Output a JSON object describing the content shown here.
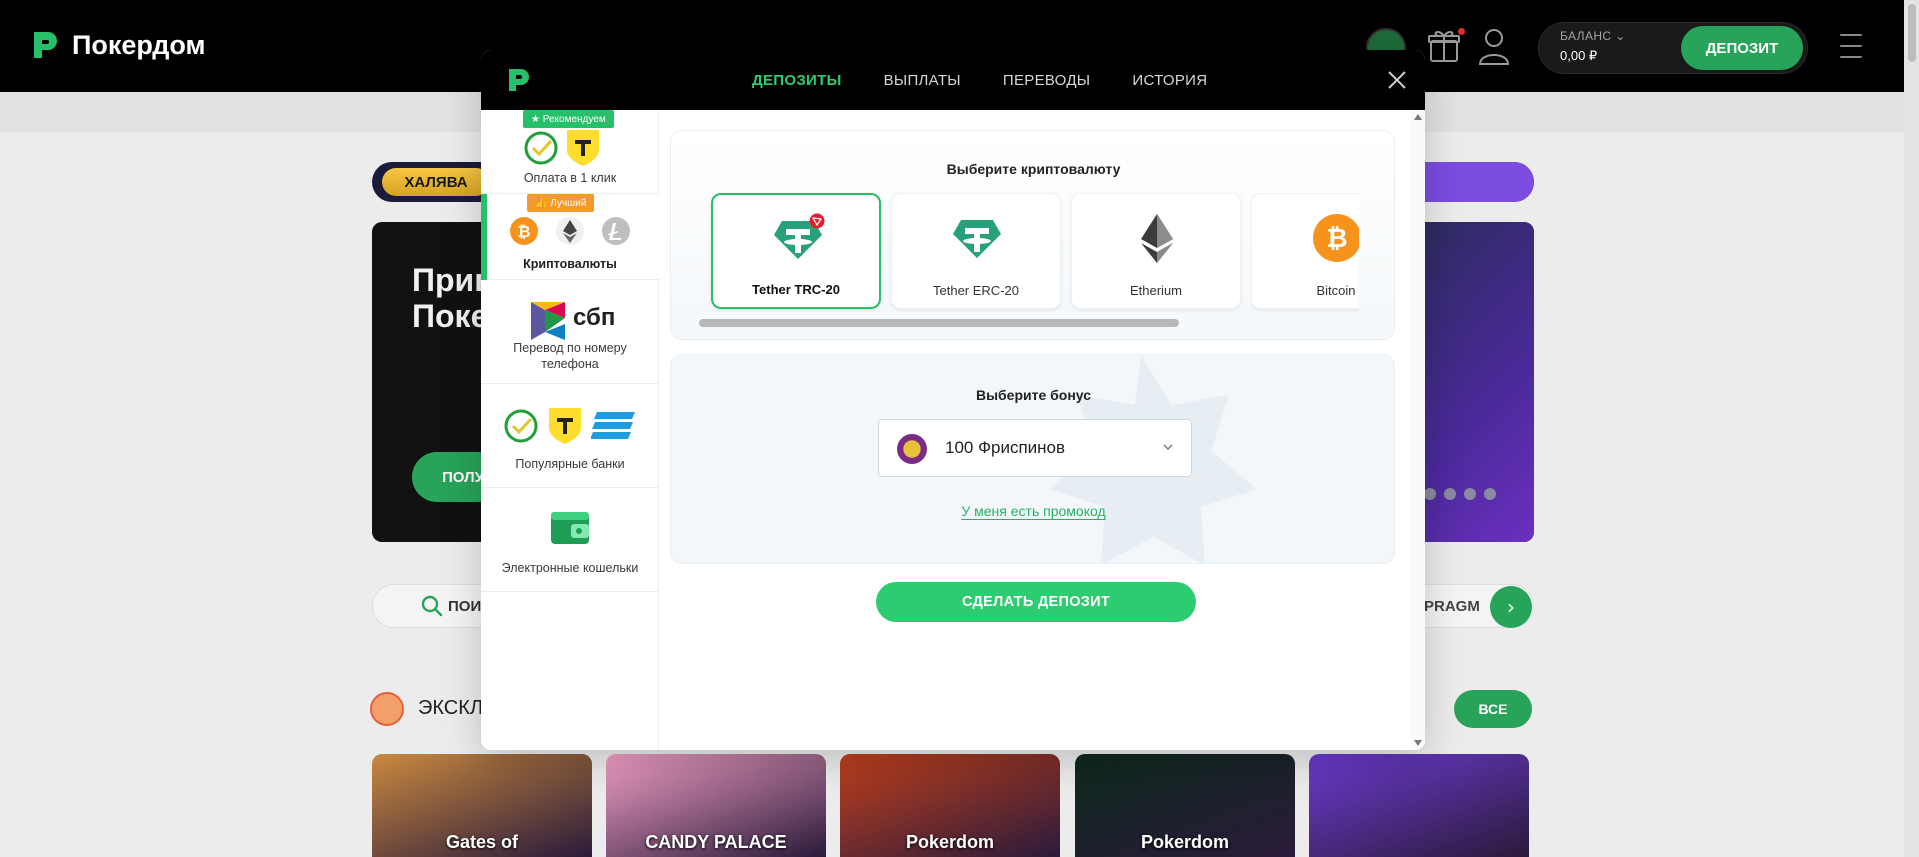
{
  "site": {
    "brand": "Покердом"
  },
  "header": {
    "balance_label": "БАЛАНС",
    "balance_value": "0,00 ₽",
    "deposit_label": "ДЕПОЗИТ"
  },
  "background": {
    "promo_badge": "ХАЛЯВА",
    "banner_title_line1": "Прив",
    "banner_title_line2": "Поке",
    "banner_button": "ПОЛУ",
    "search_text": "ПОИ",
    "provider_text": "PRAGM",
    "section_title": "ЭКСКЛ",
    "all_button": "ВСЕ",
    "games": [
      {
        "name": "Gates of",
        "bg": "#c9893f"
      },
      {
        "name": "CANDY PALACE",
        "bg": "#f2a0c6"
      },
      {
        "name": "Pokerdom",
        "bg": "#c0401c"
      },
      {
        "name": "Pokerdom",
        "bg": "#0e2a1c"
      },
      {
        "name": "",
        "bg": "#6d3bd0"
      }
    ]
  },
  "modal": {
    "tabs": [
      {
        "label": "ДЕПОЗИТЫ",
        "active": true
      },
      {
        "label": "ВЫПЛАТЫ",
        "active": false
      },
      {
        "label": "ПЕРЕВОДЫ",
        "active": false
      },
      {
        "label": "ИСТОРИЯ",
        "active": false
      }
    ],
    "methods": [
      {
        "badge": "★ Рекомендуем",
        "label": "Оплата в 1 клик"
      },
      {
        "badge": "👍 Лучший",
        "label": "Криптовалюты",
        "active": true
      },
      {
        "label": "Перевод по номеру телефона",
        "logo_text": "сбп"
      },
      {
        "label": "Популярные банки"
      },
      {
        "label": "Электронные кошельки"
      }
    ],
    "crypto": {
      "title": "Выберите криптовалюту",
      "coins": [
        {
          "name": "Tether TRC-20",
          "selected": true,
          "color": "#26a17b",
          "icon": "tether-icon"
        },
        {
          "name": "Tether ERC-20",
          "selected": false,
          "color": "#26a17b",
          "icon": "tether-icon"
        },
        {
          "name": "Etherium",
          "selected": false,
          "color": "#3c3c3d",
          "icon": "ethereum-icon"
        },
        {
          "name": "Bitcoin",
          "selected": false,
          "color": "#f7931a",
          "icon": "bitcoin-icon"
        }
      ]
    },
    "bonus": {
      "title": "Выберите бонус",
      "selected": "100 Фриспинов",
      "promo_link": "У меня есть промокод"
    },
    "submit_label": "СДЕЛАТЬ ДЕПОЗИТ"
  },
  "colors": {
    "accent": "#2ecc71",
    "dark": "#000000",
    "deposit_green": "#27a35a"
  }
}
